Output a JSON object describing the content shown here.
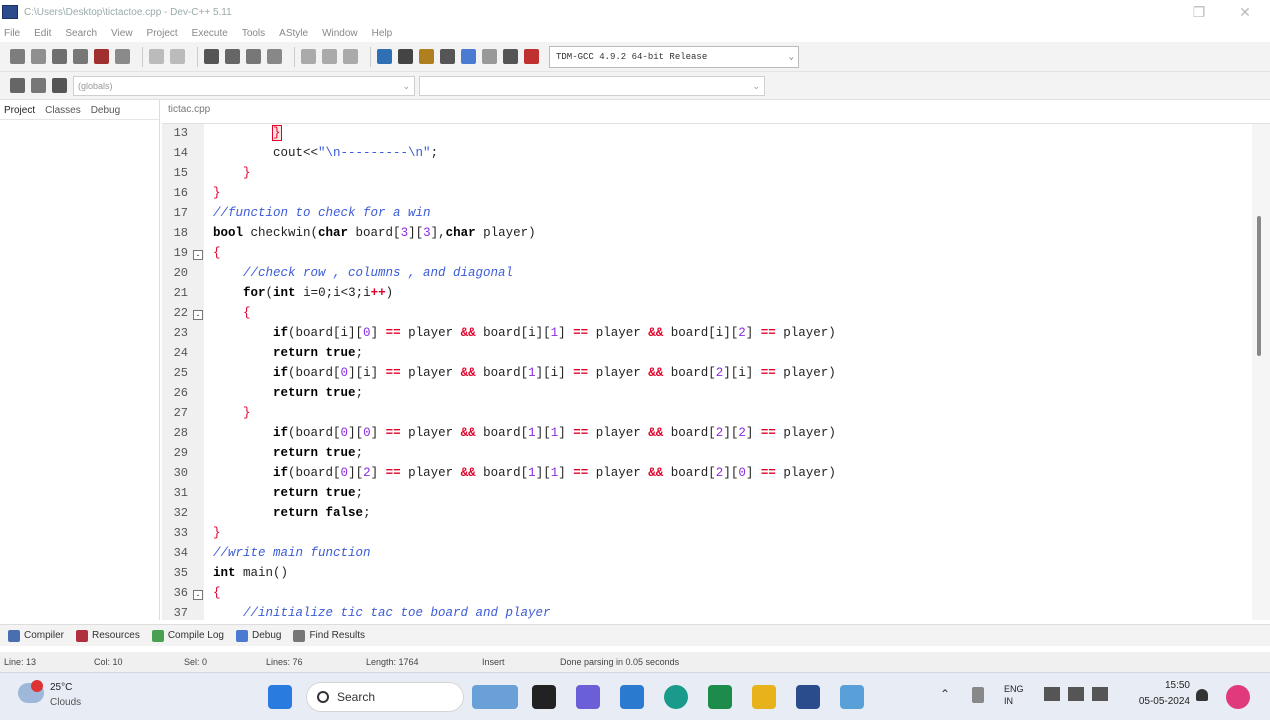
{
  "window": {
    "title": "C:\\Users\\Desktop\\tictactoe.cpp - Dev-C++ 5.11"
  },
  "menu": [
    "File",
    "Edit",
    "Search",
    "View",
    "Project",
    "Execute",
    "Tools",
    "AStyle",
    "Window",
    "Help"
  ],
  "toolbar": {
    "compiler": "TDM-GCC 4.9.2 64-bit Release",
    "globals_combo": "(globals)",
    "symbol_combo": ""
  },
  "left_tabs": [
    "Project",
    "Classes",
    "Debug"
  ],
  "editor_tab": "tictac.cpp",
  "code_lines": [
    {
      "n": "13",
      "fold": ""
    },
    {
      "n": "14",
      "fold": ""
    },
    {
      "n": "15",
      "fold": ""
    },
    {
      "n": "16",
      "fold": ""
    },
    {
      "n": "17",
      "fold": ""
    },
    {
      "n": "18",
      "fold": ""
    },
    {
      "n": "19",
      "fold": "-"
    },
    {
      "n": "20",
      "fold": ""
    },
    {
      "n": "21",
      "fold": ""
    },
    {
      "n": "22",
      "fold": "-"
    },
    {
      "n": "23",
      "fold": ""
    },
    {
      "n": "24",
      "fold": ""
    },
    {
      "n": "25",
      "fold": ""
    },
    {
      "n": "26",
      "fold": ""
    },
    {
      "n": "27",
      "fold": ""
    },
    {
      "n": "28",
      "fold": ""
    },
    {
      "n": "29",
      "fold": ""
    },
    {
      "n": "30",
      "fold": ""
    },
    {
      "n": "31",
      "fold": ""
    },
    {
      "n": "32",
      "fold": ""
    },
    {
      "n": "33",
      "fold": ""
    },
    {
      "n": "34",
      "fold": ""
    },
    {
      "n": "35",
      "fold": ""
    },
    {
      "n": "36",
      "fold": "-"
    },
    {
      "n": "37",
      "fold": ""
    }
  ],
  "code_text": [
    "        }",
    "        cout<<\"\\n---------\\n\";",
    "    }",
    "}",
    "//function to check for a win",
    "bool checkwin(char board[3][3],char player)",
    "{",
    "    //check row , columns , and diagonal",
    "    for(int i=0;i<3;i++)",
    "    {",
    "        if(board[i][0] == player && board[i][1] == player && board[i][2] == player)",
    "        return true;",
    "        if(board[0][i] == player && board[1][i] == player && board[2][i] == player)",
    "        return true;",
    "    }",
    "        if(board[0][0] == player && board[1][1] == player && board[2][2] == player)",
    "        return true;",
    "        if(board[0][2] == player && board[1][1] == player && board[2][0] == player)",
    "        return true;",
    "        return false;",
    "}",
    "//write main function",
    "int main()",
    "{",
    "    //initialize tic tac toe board and player"
  ],
  "bottom_tabs": [
    "Compiler",
    "Resources",
    "Compile Log",
    "Debug",
    "Find Results"
  ],
  "status": {
    "line": "Line: 13",
    "col": "Col: 10",
    "sel": "Sel: 0",
    "lines": "Lines: 76",
    "length": "Length: 1764",
    "mode": "Insert",
    "message": "Done parsing in 0.05 seconds"
  },
  "taskbar": {
    "weather_temp": "25°C",
    "weather_desc": "Clouds",
    "search": "Search",
    "lang": "ENG IN",
    "time": "15:50",
    "date": "05-05-2024"
  }
}
